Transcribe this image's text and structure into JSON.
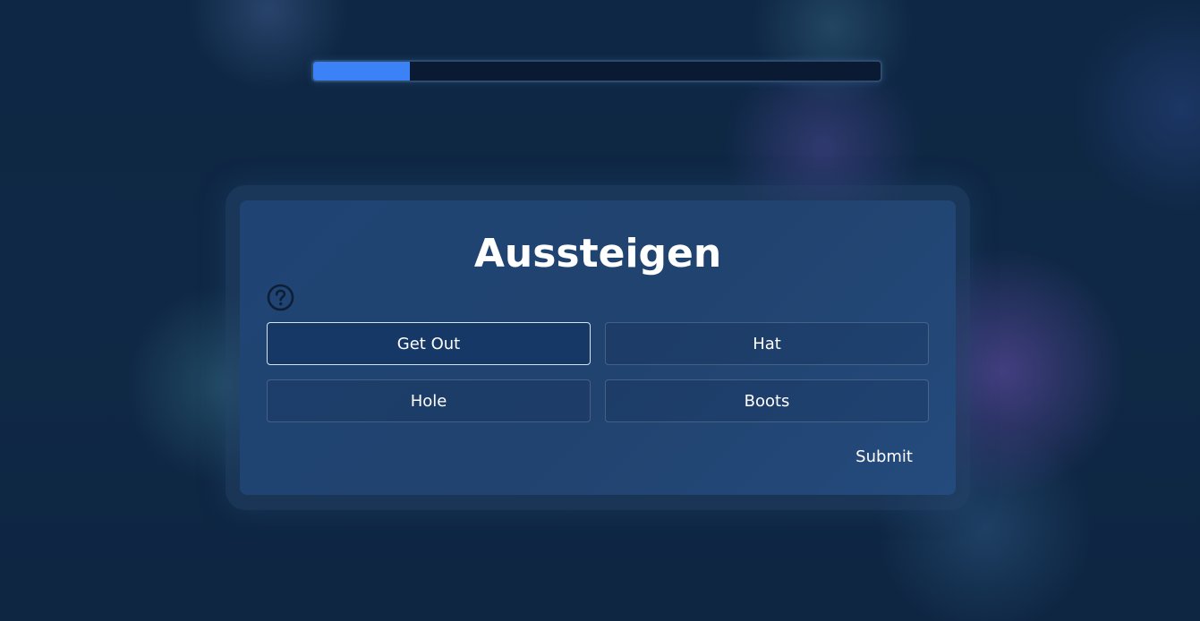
{
  "progress": {
    "fraction": 0.17,
    "fill_color": "#3b82f6"
  },
  "question": {
    "title": "Aussteigen",
    "help_icon": "question-circle-icon"
  },
  "options": [
    {
      "label": "Get Out",
      "selected": true
    },
    {
      "label": "Hat",
      "selected": false
    },
    {
      "label": "Hole",
      "selected": false
    },
    {
      "label": "Boots",
      "selected": false
    }
  ],
  "submit_label": "Submit",
  "colors": {
    "background": "#0e2744",
    "card": "#21436f",
    "accent": "#3b82f6"
  }
}
